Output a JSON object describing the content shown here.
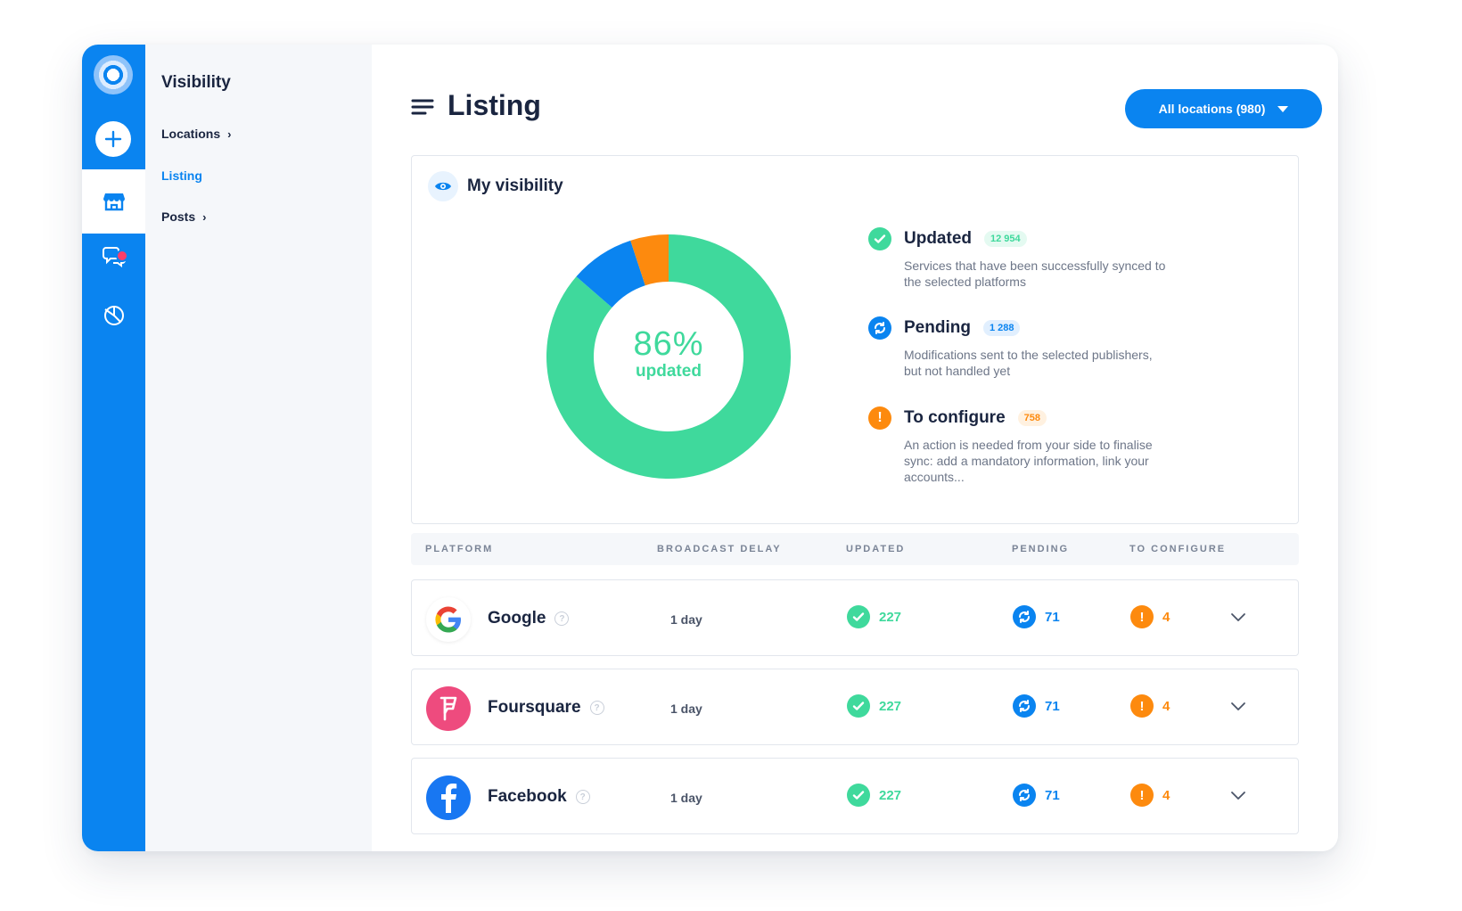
{
  "sidebar": {
    "section_title": "Visibility",
    "items": [
      {
        "label": "Locations",
        "has_chevron": true,
        "active": false
      },
      {
        "label": "Listing",
        "has_chevron": false,
        "active": true
      },
      {
        "label": "Posts",
        "has_chevron": true,
        "active": false
      }
    ],
    "rail_icons": [
      "logo-icon",
      "add-icon",
      "store-icon",
      "chat-icon",
      "analytics-icon"
    ]
  },
  "header": {
    "title": "Listing",
    "locations_button": "All locations (980)"
  },
  "visibility": {
    "title": "My visibility",
    "percent_label": "86%",
    "percent_caption": "updated",
    "legend": [
      {
        "label": "Updated",
        "count": "12 954",
        "description": "Services that have been successfully synced to the selected platforms",
        "color": "#3fd99c",
        "icon": "check-icon"
      },
      {
        "label": "Pending",
        "count": "1 288",
        "description": "Modifications sent to the selected publishers, but not handled yet",
        "color": "#0a84f0",
        "icon": "sync-icon"
      },
      {
        "label": "To configure",
        "count": "758",
        "description": "An action is needed from your side to finalise sync: add a mandatory information, link your accounts...",
        "color": "#fd8a0e",
        "icon": "alert-icon"
      }
    ]
  },
  "chart_data": {
    "type": "pie",
    "categories": [
      "Updated",
      "Pending",
      "To configure"
    ],
    "values": [
      12954,
      1288,
      758
    ],
    "colors": [
      "#3fd99c",
      "#0a84f0",
      "#fd8a0e"
    ],
    "center_text": "86% updated"
  },
  "table": {
    "headers": [
      "PLATFORM",
      "BROADCAST DELAY",
      "UPDATED",
      "PENDING",
      "TO CONFIGURE"
    ],
    "rows": [
      {
        "platform": "Google",
        "delay": "1 day",
        "updated": "227",
        "pending": "71",
        "to_configure": "4"
      },
      {
        "platform": "Foursquare",
        "delay": "1 day",
        "updated": "227",
        "pending": "71",
        "to_configure": "4"
      },
      {
        "platform": "Facebook",
        "delay": "1 day",
        "updated": "227",
        "pending": "71",
        "to_configure": "4"
      }
    ]
  },
  "colors": {
    "primary": "#0a84f0",
    "success": "#3fd99c",
    "warning": "#fd8a0e",
    "foursquare": "#ee4b7e",
    "facebook": "#1877f2",
    "notification": "#ff3d6a"
  }
}
